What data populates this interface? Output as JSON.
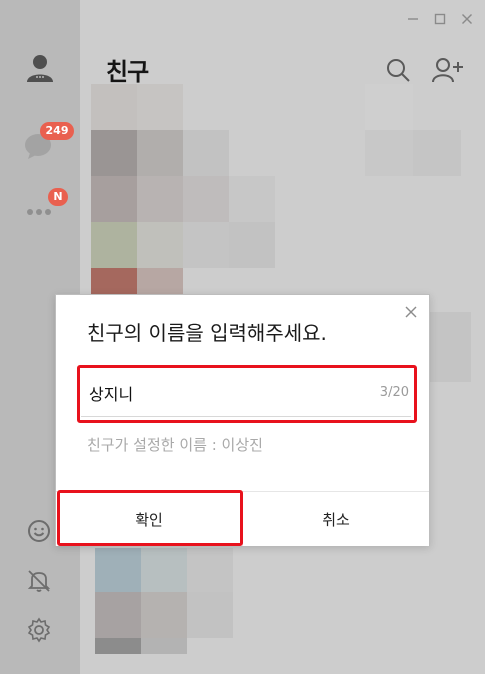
{
  "window": {
    "title": "친구",
    "controls": [
      "minimize-icon",
      "maximize-icon",
      "close-icon"
    ]
  },
  "sidebar": {
    "items": [
      {
        "icon": "person-icon",
        "name": "friends"
      },
      {
        "icon": "chat-bubble-icon",
        "name": "chats",
        "badge": "249"
      },
      {
        "icon": "more-dots-icon",
        "name": "more",
        "badge": "N"
      }
    ],
    "bottom": [
      {
        "icon": "emoticon-icon"
      },
      {
        "icon": "bell-off-icon"
      },
      {
        "icon": "gear-icon"
      }
    ]
  },
  "header": {
    "search_icon": "search-icon",
    "add_friend_icon": "add-friend-icon"
  },
  "dialog": {
    "title": "친구의 이름을 입력해주세요.",
    "input_value": "상지니",
    "char_count": "3/20",
    "friend_set_name": "친구가 설정한 이름 : 이상진",
    "confirm_label": "확인",
    "cancel_label": "취소"
  },
  "colors": {
    "badge": "#e9604f",
    "highlight_box": "#e8111c",
    "sidebar_bg": "#b9b9b9",
    "content_bg": "#cdcdcd"
  }
}
